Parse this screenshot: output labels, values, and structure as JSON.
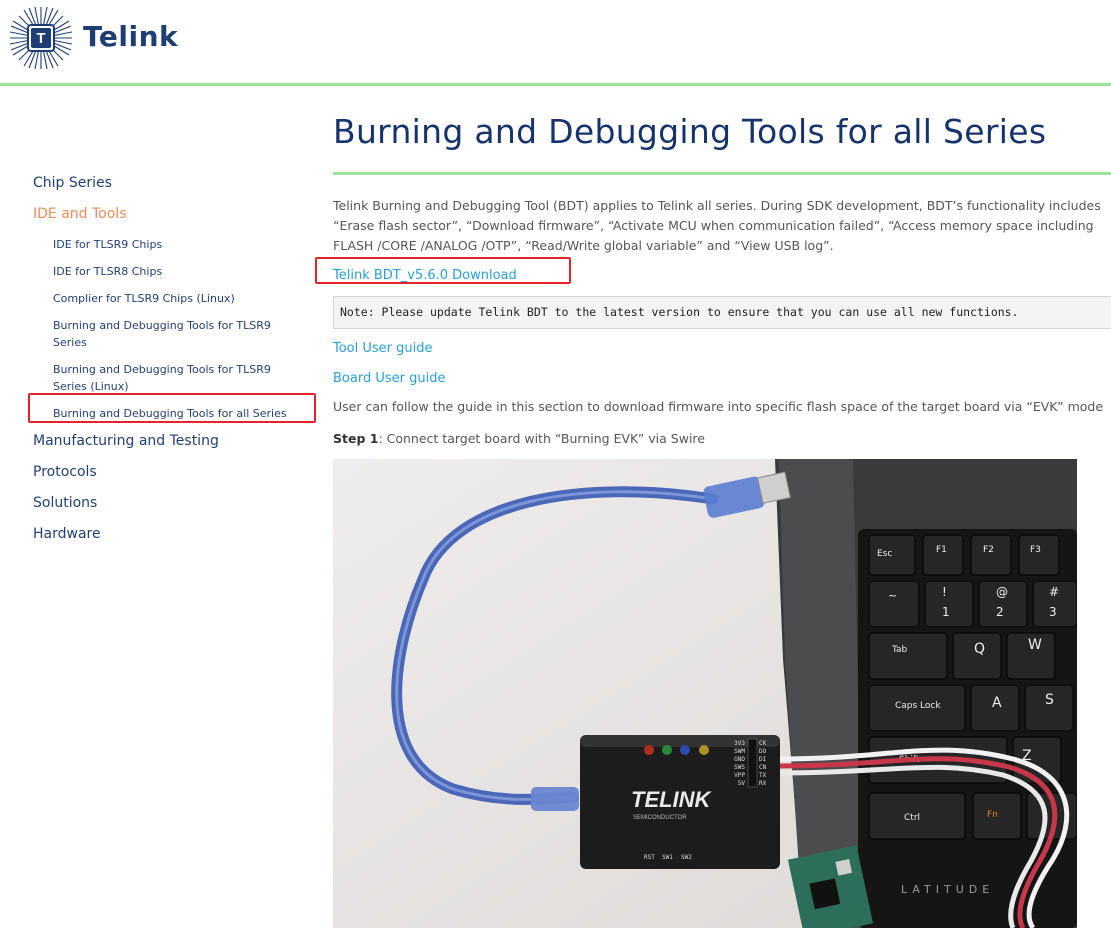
{
  "header": {
    "brand": "Telink",
    "logo_letter": "T"
  },
  "sidebar": {
    "items": [
      {
        "label": "Chip Series"
      },
      {
        "label": "IDE and Tools"
      },
      {
        "label": "Manufacturing and Testing"
      },
      {
        "label": "Protocols"
      },
      {
        "label": "Solutions"
      },
      {
        "label": "Hardware"
      }
    ],
    "sub_items": [
      {
        "label": "IDE for TLSR9 Chips"
      },
      {
        "label": "IDE for TLSR8 Chips"
      },
      {
        "label": "Complier for TLSR9 Chips (Linux)"
      },
      {
        "label": "Burning and Debugging Tools for TLSR9 Series"
      },
      {
        "label": "Burning and Debugging Tools for TLSR9 Series (Linux)"
      },
      {
        "label": "Burning and Debugging Tools for all Series"
      }
    ]
  },
  "main": {
    "title": "Burning and Debugging Tools for all Series",
    "intro": "Telink Burning and Debugging Tool (BDT) applies to Telink all series. During SDK development, BDT’s functionality includes “Erase flash sector”, “Download firmware”, “Activate MCU when communication failed”, “Access memory space including FLASH /CORE /ANALOG /OTP”, “Read/Write global variable” and “View USB log”.",
    "download_link": "Telink BDT_v5.6.0 Download",
    "note": "Note: Please update Telink BDT to the latest version to ensure that you can use all new functions.",
    "tool_guide_link": "Tool User guide",
    "board_guide_link": "Board User guide",
    "para": "User can follow the guide in this section to download firmware into specific flash space of the target board via “EVK” mode",
    "step_label": "Step 1",
    "step_text": ": Connect target board with “Burning EVK” via Swire"
  },
  "photo": {
    "evk_brand": "TELINK",
    "evk_sub": "SEMICONDUCTOR",
    "evk_pins_left": [
      "3V3",
      "SWM",
      "GND",
      "SWS",
      "VPP",
      "5V"
    ],
    "evk_pins_right": [
      "CK",
      "DO",
      "DI",
      "CN",
      "TX",
      "RX"
    ],
    "evk_buttons": [
      "RST",
      "SW1",
      "SW2"
    ],
    "laptop_brand": "LATITUDE",
    "keys": {
      "esc": "Esc",
      "f1": "F1",
      "f2": "F2",
      "f3": "F3",
      "tilde": "~",
      "n1": "1",
      "n2": "2",
      "n3": "3",
      "s1": "!",
      "s2": "@",
      "s3": "#",
      "tab": "Tab",
      "q": "Q",
      "w": "W",
      "caps": "Caps Lock",
      "a": "A",
      "s": "S",
      "shift": "Shift",
      "z": "Z",
      "ctrl": "Ctrl",
      "fn": "Fn"
    }
  },
  "colors": {
    "accent_green": "#9fe29a",
    "link": "#2a9fd8",
    "active": "#f08c5a",
    "highlight": "#e5232a",
    "navy": "#16346b"
  }
}
